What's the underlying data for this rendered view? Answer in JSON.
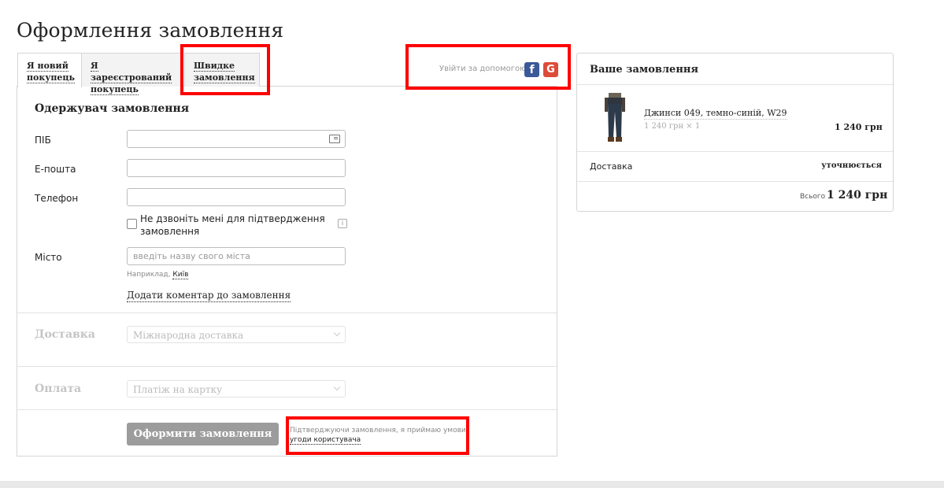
{
  "page_title": "Оформлення замовлення",
  "tabs": [
    {
      "label": "Я новий покупець"
    },
    {
      "label": "Я зареєстрований покупець"
    },
    {
      "label": "Швидке замовлення"
    }
  ],
  "social": {
    "label": "Увійти за допомогою",
    "facebook_icon": "facebook-icon",
    "google_icon": "google-icon",
    "facebook_glyph": "f",
    "google_glyph": "G",
    "facebook_color": "#3b5998",
    "google_color": "#dd4b39"
  },
  "recipient": {
    "title": "Одержувач замовлення",
    "name_label": "ПІБ",
    "name_value": "",
    "email_label": "Е-пошта",
    "email_value": "",
    "phone_label": "Телефон",
    "phone_value": "",
    "no_call_label": "Не дзвоніть мені для підтвердження замовлення",
    "info_glyph": "i",
    "city_label": "Місто",
    "city_placeholder": "введіть назву свого міста",
    "city_hint_prefix": "Наприклад,",
    "city_hint_example": "Київ",
    "add_comment": "Додати коментар до замовлення"
  },
  "delivery": {
    "title": "Доставка",
    "selected": "Міжнародна доставка"
  },
  "payment": {
    "title": "Оплата",
    "selected": "Платіж на картку"
  },
  "submit": {
    "label": "Оформити замовлення",
    "terms_text": "Підтверджуючи замовлення, я приймаю умови",
    "terms_link": "угоди користувача"
  },
  "order": {
    "title": "Ваше замовлення",
    "product_name": "Джинси 049, темно-синій, W29",
    "product_qty": "1 240 грн × 1",
    "product_price": "1 240 грн",
    "delivery_label": "Доставка",
    "delivery_value": "уточнюється",
    "total_label": "Всього",
    "total_value": "1 240 грн"
  },
  "colors": {
    "annotation_red": "#ff0000",
    "submit_disabled": "#9c9c9c"
  }
}
